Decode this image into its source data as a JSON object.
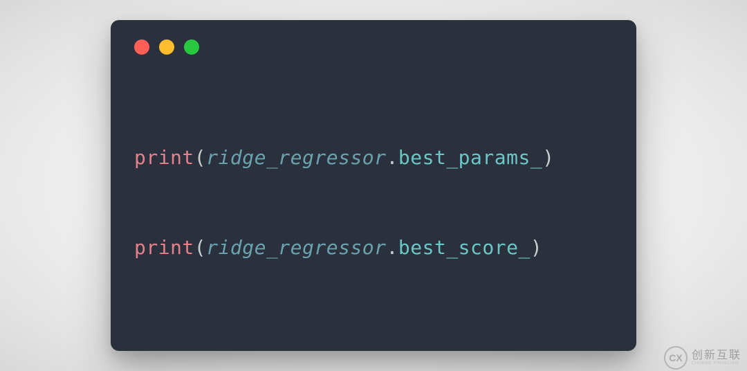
{
  "code": {
    "lines": [
      {
        "fn": "print",
        "open": "(",
        "obj": "ridge_regressor",
        "dot": ".",
        "attr": "best_params_",
        "close": ")"
      },
      {
        "fn": "print",
        "open": "(",
        "obj": "ridge_regressor",
        "dot": ".",
        "attr": "best_score_",
        "close": ")"
      }
    ]
  },
  "watermark": {
    "logo": "CX",
    "main": "创新互联",
    "sub": "CHUANG XINHULIAN"
  }
}
